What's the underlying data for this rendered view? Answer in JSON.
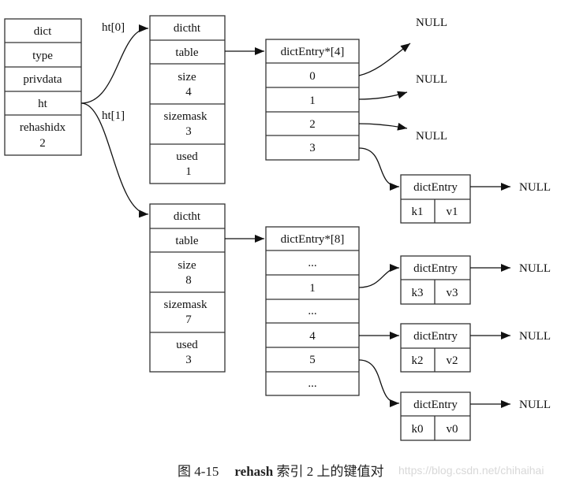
{
  "dict": {
    "title": "dict",
    "fields": [
      "type",
      "privdata",
      "ht"
    ],
    "rehashidx_label": "rehashidx",
    "rehashidx_value": "2"
  },
  "edge_labels": {
    "ht0": "ht[0]",
    "ht1": "ht[1]"
  },
  "ht0": {
    "title": "dictht",
    "table": "table",
    "size_label": "size",
    "size_value": "4",
    "sizemask_label": "sizemask",
    "sizemask_value": "3",
    "used_label": "used",
    "used_value": "1"
  },
  "ht1": {
    "title": "dictht",
    "table": "table",
    "size_label": "size",
    "size_value": "8",
    "sizemask_label": "sizemask",
    "sizemask_value": "7",
    "used_label": "used",
    "used_value": "3"
  },
  "table0": {
    "title": "dictEntry*[4]",
    "slots": [
      "0",
      "1",
      "2",
      "3"
    ]
  },
  "table1": {
    "title": "dictEntry*[8]",
    "slots": [
      "...",
      "1",
      "...",
      "4",
      "5",
      "..."
    ]
  },
  "entries": [
    {
      "title": "dictEntry",
      "key": "k1",
      "value": "v1"
    },
    {
      "title": "dictEntry",
      "key": "k3",
      "value": "v3"
    },
    {
      "title": "dictEntry",
      "key": "k2",
      "value": "v2"
    },
    {
      "title": "dictEntry",
      "key": "k0",
      "value": "v0"
    }
  ],
  "null_label": "NULL",
  "caption": {
    "figure": "图 4-15",
    "bold": "rehash",
    "text": " 索引 2 上的键值对"
  },
  "watermark": "https://blog.csdn.net/chihaihai"
}
